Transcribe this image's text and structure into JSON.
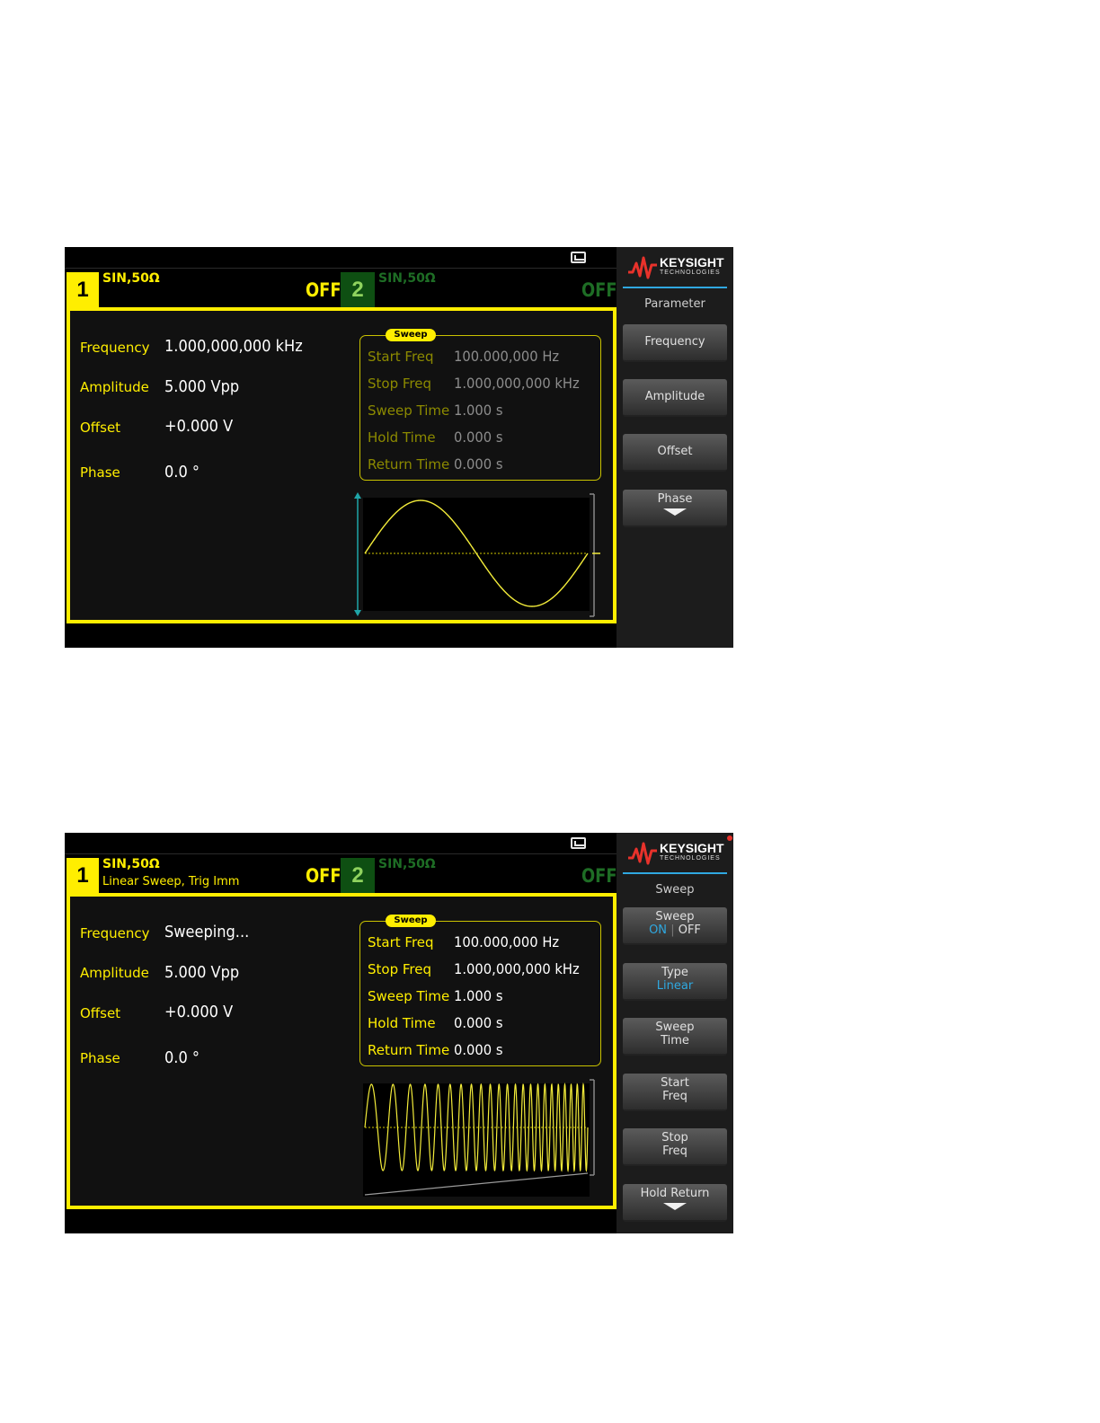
{
  "screen1": {
    "channel1": {
      "number": "1",
      "info": "SIN,50Ω",
      "state": "OFF"
    },
    "channel2": {
      "number": "2",
      "info": "SIN,50Ω",
      "state": "OFF"
    },
    "params": [
      {
        "label": "Frequency",
        "value": "1.000,000,000 kHz"
      },
      {
        "label": "Amplitude",
        "value": "5.000 Vpp"
      },
      {
        "label": "Offset",
        "value": "+0.000 V"
      },
      {
        "label": "Phase",
        "value": "0.0 °"
      }
    ],
    "sweep": {
      "tag": "Sweep",
      "rows": [
        {
          "label": "Start Freq",
          "value": "100.000,000 Hz"
        },
        {
          "label": "Stop Freq",
          "value": "1.000,000,000 kHz"
        },
        {
          "label": "Sweep Time",
          "value": "1.000 s"
        },
        {
          "label": "Hold Time",
          "value": "0.000 s"
        },
        {
          "label": "Return Time",
          "value": "0.000 s"
        }
      ]
    },
    "softpanel": {
      "brand": "KEYSIGHT",
      "brand_sub": "TECHNOLOGIES",
      "menu_title": "Parameter",
      "keys": [
        {
          "line1": "Frequency"
        },
        {
          "line1": "Amplitude"
        },
        {
          "line1": "Offset"
        },
        {
          "line1": "Phase"
        }
      ]
    }
  },
  "screen2": {
    "channel1": {
      "number": "1",
      "info": "SIN,50Ω",
      "sub": "Linear Sweep, Trig Imm",
      "state": "OFF"
    },
    "channel2": {
      "number": "2",
      "info": "SIN,50Ω",
      "state": "OFF"
    },
    "params": [
      {
        "label": "Frequency",
        "value": "Sweeping..."
      },
      {
        "label": "Amplitude",
        "value": "5.000 Vpp"
      },
      {
        "label": "Offset",
        "value": "+0.000 V"
      },
      {
        "label": "Phase",
        "value": "0.0 °"
      }
    ],
    "sweep": {
      "tag": "Sweep",
      "rows": [
        {
          "label": "Start Freq",
          "value": "100.000,000 Hz"
        },
        {
          "label": "Stop Freq",
          "value": "1.000,000,000 kHz"
        },
        {
          "label": "Sweep Time",
          "value": "1.000 s"
        },
        {
          "label": "Hold Time",
          "value": "0.000 s"
        },
        {
          "label": "Return Time",
          "value": "0.000 s"
        }
      ]
    },
    "softpanel": {
      "brand": "KEYSIGHT",
      "brand_sub": "TECHNOLOGIES",
      "menu_title": "Sweep",
      "keys": [
        {
          "line1": "Sweep",
          "on": "ON",
          "sep": "|",
          "off": "OFF"
        },
        {
          "line1": "Type",
          "line2": "Linear"
        },
        {
          "line1": "Sweep",
          "line2": "Time"
        },
        {
          "line1": "Start",
          "line2": "Freq"
        },
        {
          "line1": "Stop",
          "line2": "Freq"
        },
        {
          "line1": "Hold Return"
        }
      ]
    }
  },
  "colors": {
    "accent_yellow": "#ffee00",
    "channel2_green": "#1e6d25",
    "highlight_blue": "#2fa8e0",
    "keysight_red": "#e8322b"
  },
  "icons": {
    "usb": "usb-drive-icon",
    "logo": "keysight-wave-logo-icon",
    "more": "arrow-down-icon"
  }
}
